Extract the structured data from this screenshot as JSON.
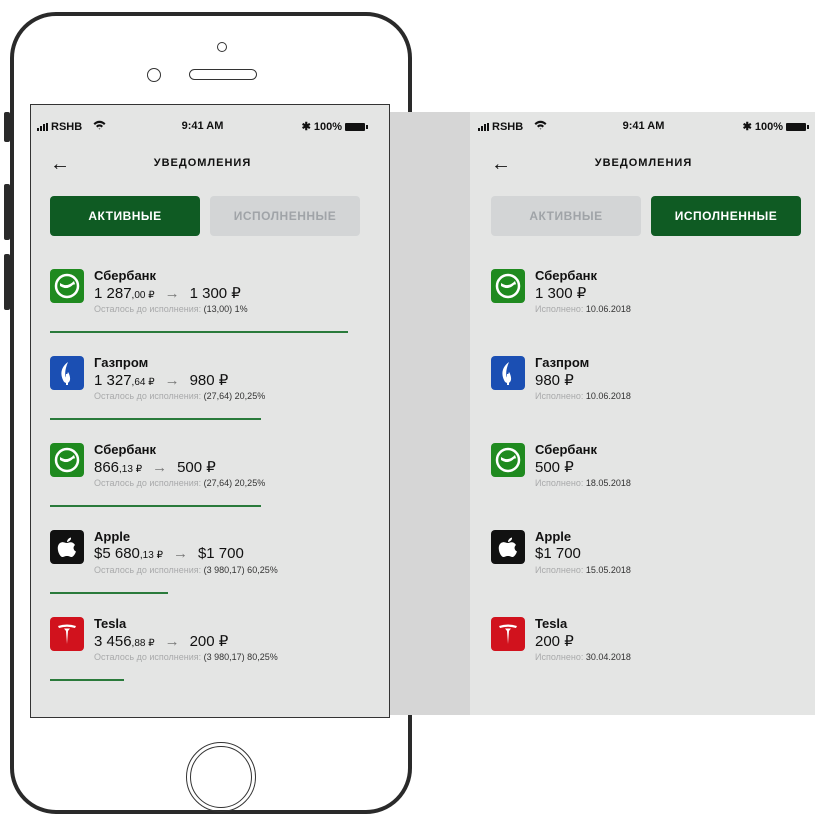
{
  "status": {
    "carrier": "RSHB",
    "time": "9:41 AM",
    "battery": "100%"
  },
  "nav": {
    "title": "УВЕДОМЛЕНИЯ"
  },
  "tabs": {
    "active": "АКТИВНЫЕ",
    "done": "ИСПОЛНЕННЫЕ"
  },
  "colors": {
    "accent": "#0f5b23",
    "sber": "#1f8a1f",
    "gazprom": "#1b4fb3",
    "apple": "#111111",
    "tesla": "#d1121d"
  },
  "active_items": [
    {
      "name": "Сбербанк",
      "logo": "sber-logo-icon",
      "price_int": "1 287",
      "price_dec": ",00 ₽",
      "arrow": "→",
      "target": "1 300 ₽",
      "meta_label": "Осталось до исполнения:",
      "meta_value": "(13,00) 1%",
      "progress": 0.96
    },
    {
      "name": "Газпром",
      "logo": "gazprom-logo-icon",
      "price_int": "1 327",
      "price_dec": ",64 ₽",
      "arrow": "→",
      "target": "980 ₽",
      "meta_label": "Осталось до исполнения:",
      "meta_value": "(27,64) 20,25%",
      "progress": 0.68
    },
    {
      "name": "Сбербанк",
      "logo": "sber-logo-icon",
      "price_int": "866",
      "price_dec": ",13 ₽",
      "arrow": "→",
      "target": "500 ₽",
      "meta_label": "Осталось до исполнения:",
      "meta_value": "(27,64) 20,25%",
      "progress": 0.68
    },
    {
      "name": "Apple",
      "logo": "apple-logo-icon",
      "price_int": "$5 680",
      "price_dec": ",13 ₽",
      "arrow": "→",
      "target": "$1 700",
      "meta_label": "Осталось до исполнения:",
      "meta_value": "(3 980,17) 60,25%",
      "progress": 0.38
    },
    {
      "name": "Tesla",
      "logo": "tesla-logo-icon",
      "price_int": "3 456",
      "price_dec": ",88 ₽",
      "arrow": "→",
      "target": "200 ₽",
      "meta_label": "Осталось до исполнения:",
      "meta_value": "(3 980,17) 80,25%",
      "progress": 0.24
    }
  ],
  "done_items": [
    {
      "name": "Сбербанк",
      "logo": "sber-logo-icon",
      "price": "1 300 ₽",
      "meta_label": "Исполнено:",
      "meta_value": "10.06.2018"
    },
    {
      "name": "Газпром",
      "logo": "gazprom-logo-icon",
      "price": "980 ₽",
      "meta_label": "Исполнено:",
      "meta_value": "10.06.2018"
    },
    {
      "name": "Сбербанк",
      "logo": "sber-logo-icon",
      "price": "500 ₽",
      "meta_label": "Исполнено:",
      "meta_value": "18.05.2018"
    },
    {
      "name": "Apple",
      "logo": "apple-logo-icon",
      "price": "$1 700",
      "meta_label": "Исполнено:",
      "meta_value": "15.05.2018"
    },
    {
      "name": "Tesla",
      "logo": "tesla-logo-icon",
      "price": "200 ₽",
      "meta_label": "Исполнено:",
      "meta_value": "30.04.2018"
    }
  ]
}
